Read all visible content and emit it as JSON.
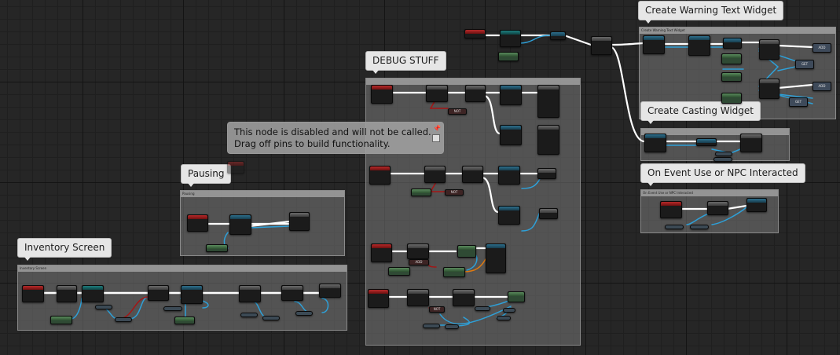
{
  "graph": {
    "comments": [
      {
        "id": "inventory",
        "title": "Inventory Screen",
        "header": "Inventory Screen"
      },
      {
        "id": "pausing",
        "title": "Pausing",
        "header": "Pausing"
      },
      {
        "id": "debug",
        "title": "DEBUG STUFF",
        "header": ""
      },
      {
        "id": "warning",
        "title": "Create Warning Text Widget",
        "header": "Create Warning Text Widget"
      },
      {
        "id": "casting",
        "title": "Create Casting Widget",
        "header": ""
      },
      {
        "id": "npc",
        "title": "On Event Use or NPC Interacted",
        "header": "On Event Use or NPC Interacted"
      }
    ],
    "tooltip": {
      "line1": "This node is disabled and will not be called.",
      "line2": "Drag off pins to build functionality."
    },
    "mini_labels": {
      "not": "NOT",
      "add": "ADD",
      "get": "GET"
    },
    "colors": {
      "exec_wire": "#ffffff",
      "object_wire": "#2ea0d8",
      "bool_wire": "#a41515",
      "float_wire": "#e07a10",
      "grid_bg": "#262626"
    }
  }
}
